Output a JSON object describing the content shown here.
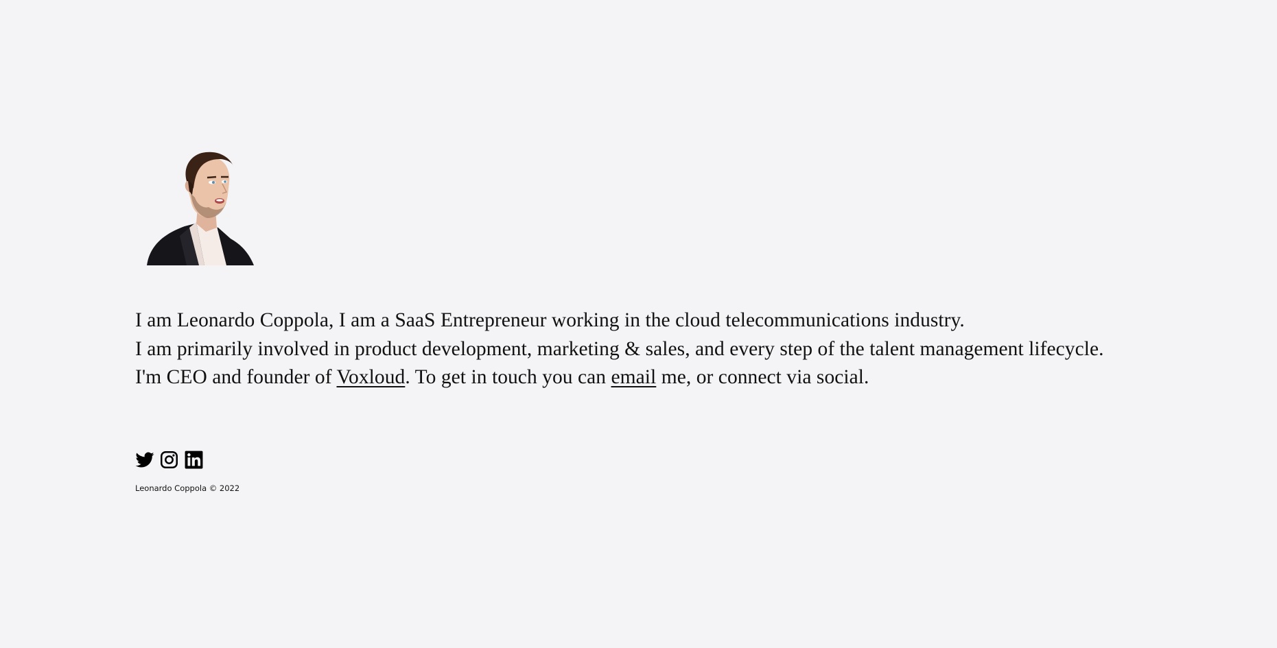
{
  "profile": {
    "avatar_alt": "Leonardo Coppola illustrated portrait"
  },
  "bio": {
    "line1": "I am Leonardo Coppola, I am a SaaS Entrepreneur working in the cloud telecommunications industry.",
    "line2": "I am primarily involved in product development, marketing & sales, and every step of the talent management lifecycle.",
    "line3_prefix": "I'm CEO and founder of ",
    "company_link": "Voxloud",
    "line3_middle": ". To get in touch you can ",
    "email_link": "email",
    "line3_suffix": " me, or connect via social."
  },
  "social": [
    {
      "name": "Twitter",
      "icon": "twitter-icon"
    },
    {
      "name": "Instagram",
      "icon": "instagram-icon"
    },
    {
      "name": "LinkedIn",
      "icon": "linkedin-icon"
    }
  ],
  "footer": {
    "copyright": "Leonardo Coppola © 2022"
  },
  "colors": {
    "background": "#f4f4f6",
    "text": "#111111"
  }
}
